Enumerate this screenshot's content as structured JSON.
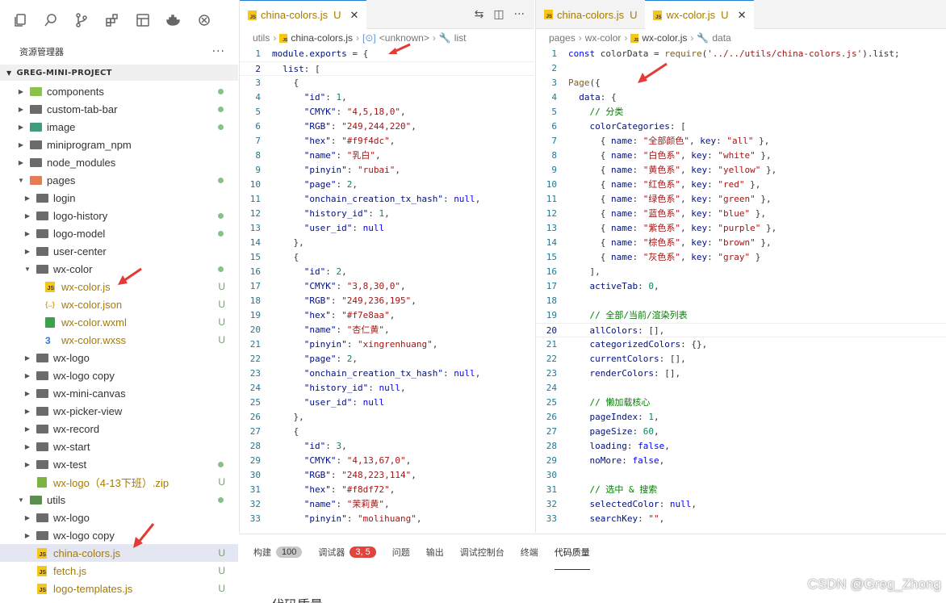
{
  "sidebar": {
    "title": "资源管理器",
    "more": "···",
    "project": "GREG-MINI-PROJECT",
    "items": [
      {
        "label": "components",
        "status": "dot"
      },
      {
        "label": "custom-tab-bar",
        "status": "dot"
      },
      {
        "label": "image",
        "status": "dot"
      },
      {
        "label": "miniprogram_npm",
        "status": ""
      },
      {
        "label": "node_modules",
        "status": ""
      },
      {
        "label": "pages",
        "status": "dot"
      },
      {
        "label": "login",
        "status": ""
      },
      {
        "label": "logo-history",
        "status": "dot"
      },
      {
        "label": "logo-model",
        "status": "dot"
      },
      {
        "label": "user-center",
        "status": ""
      },
      {
        "label": "wx-color",
        "status": "dot"
      },
      {
        "label": "wx-color.js",
        "status": "U"
      },
      {
        "label": "wx-color.json",
        "status": "U"
      },
      {
        "label": "wx-color.wxml",
        "status": "U"
      },
      {
        "label": "wx-color.wxss",
        "status": "U"
      },
      {
        "label": "wx-logo",
        "status": ""
      },
      {
        "label": "wx-logo copy",
        "status": ""
      },
      {
        "label": "wx-mini-canvas",
        "status": ""
      },
      {
        "label": "wx-picker-view",
        "status": ""
      },
      {
        "label": "wx-record",
        "status": ""
      },
      {
        "label": "wx-start",
        "status": ""
      },
      {
        "label": "wx-test",
        "status": "dot"
      },
      {
        "label": "wx-logo（4-13下班）.zip",
        "status": "U"
      },
      {
        "label": "utils",
        "status": "dot"
      },
      {
        "label": "wx-logo",
        "status": ""
      },
      {
        "label": "wx-logo copy",
        "status": ""
      },
      {
        "label": "china-colors.js",
        "status": "U"
      },
      {
        "label": "fetch.js",
        "status": "U"
      },
      {
        "label": "logo-templates.js",
        "status": "U"
      }
    ]
  },
  "editor1": {
    "tab_label": "china-colors.js",
    "tab_status": "U",
    "close": "✕",
    "breadcrumb": [
      "utils",
      "china-colors.js",
      "<unknown>",
      "list"
    ],
    "lines": [
      "module.exports = {",
      "  list: [",
      "    {",
      "      \"id\": 1,",
      "      \"CMYK\": \"4,5,18,0\",",
      "      \"RGB\": \"249,244,220\",",
      "      \"hex\": \"#f9f4dc\",",
      "      \"name\": \"乳白\",",
      "      \"pinyin\": \"rubai\",",
      "      \"page\": 2,",
      "      \"onchain_creation_tx_hash\": null,",
      "      \"history_id\": 1,",
      "      \"user_id\": null",
      "    },",
      "    {",
      "      \"id\": 2,",
      "      \"CMYK\": \"3,8,30,0\",",
      "      \"RGB\": \"249,236,195\",",
      "      \"hex\": \"#f7e8aa\",",
      "      \"name\": \"杏仁黄\",",
      "      \"pinyin\": \"xingrenhuang\",",
      "      \"page\": 2,",
      "      \"onchain_creation_tx_hash\": null,",
      "      \"history_id\": null,",
      "      \"user_id\": null",
      "    },",
      "    {",
      "      \"id\": 3,",
      "      \"CMYK\": \"4,13,67,0\",",
      "      \"RGB\": \"248,223,114\",",
      "      \"hex\": \"#f8df72\",",
      "      \"name\": \"茉莉黄\",",
      "      \"pinyin\": \"molihuang\","
    ]
  },
  "editor2": {
    "tab_inactive_label": "china-colors.js",
    "tab_inactive_status": "U",
    "tab_label": "wx-color.js",
    "tab_status": "U",
    "close": "✕",
    "breadcrumb": [
      "pages",
      "wx-color",
      "wx-color.js",
      "data"
    ],
    "lines": [
      "const colorData = require('../../utils/china-colors.js').list;",
      "",
      "Page({",
      "  data: {",
      "    // 分类",
      "    colorCategories: [",
      "      { name: \"全部颜色\", key: \"all\" },",
      "      { name: \"白色系\", key: \"white\" },",
      "      { name: \"黄色系\", key: \"yellow\" },",
      "      { name: \"红色系\", key: \"red\" },",
      "      { name: \"绿色系\", key: \"green\" },",
      "      { name: \"蓝色系\", key: \"blue\" },",
      "      { name: \"紫色系\", key: \"purple\" },",
      "      { name: \"棕色系\", key: \"brown\" },",
      "      { name: \"灰色系\", key: \"gray\" }",
      "    ],",
      "    activeTab: 0,",
      "",
      "    // 全部/当前/渲染列表",
      "    allColors: [],",
      "    categorizedColors: {},",
      "    currentColors: [],",
      "    renderColors: [],",
      "",
      "    // 懒加载核心",
      "    pageIndex: 1,",
      "    pageSize: 60,",
      "    loading: false,",
      "    noMore: false,",
      "",
      "    // 选中 & 搜索",
      "    selectedColor: null,",
      "    searchKey: \"\","
    ]
  },
  "panel": {
    "tabs": [
      {
        "label": "构建",
        "badge": "100"
      },
      {
        "label": "调试器",
        "badge": "3, 5"
      },
      {
        "label": "问题",
        "badge": ""
      },
      {
        "label": "输出",
        "badge": ""
      },
      {
        "label": "调试控制台",
        "badge": ""
      },
      {
        "label": "终端",
        "badge": ""
      },
      {
        "label": "代码质量",
        "badge": ""
      }
    ],
    "heading": "代码质量"
  },
  "watermark": "CSDN @Greg_Zhong",
  "colors": {
    "accent": "#1f7cd5",
    "untracked": "#a67c00",
    "red_arrow": "#e53935"
  }
}
